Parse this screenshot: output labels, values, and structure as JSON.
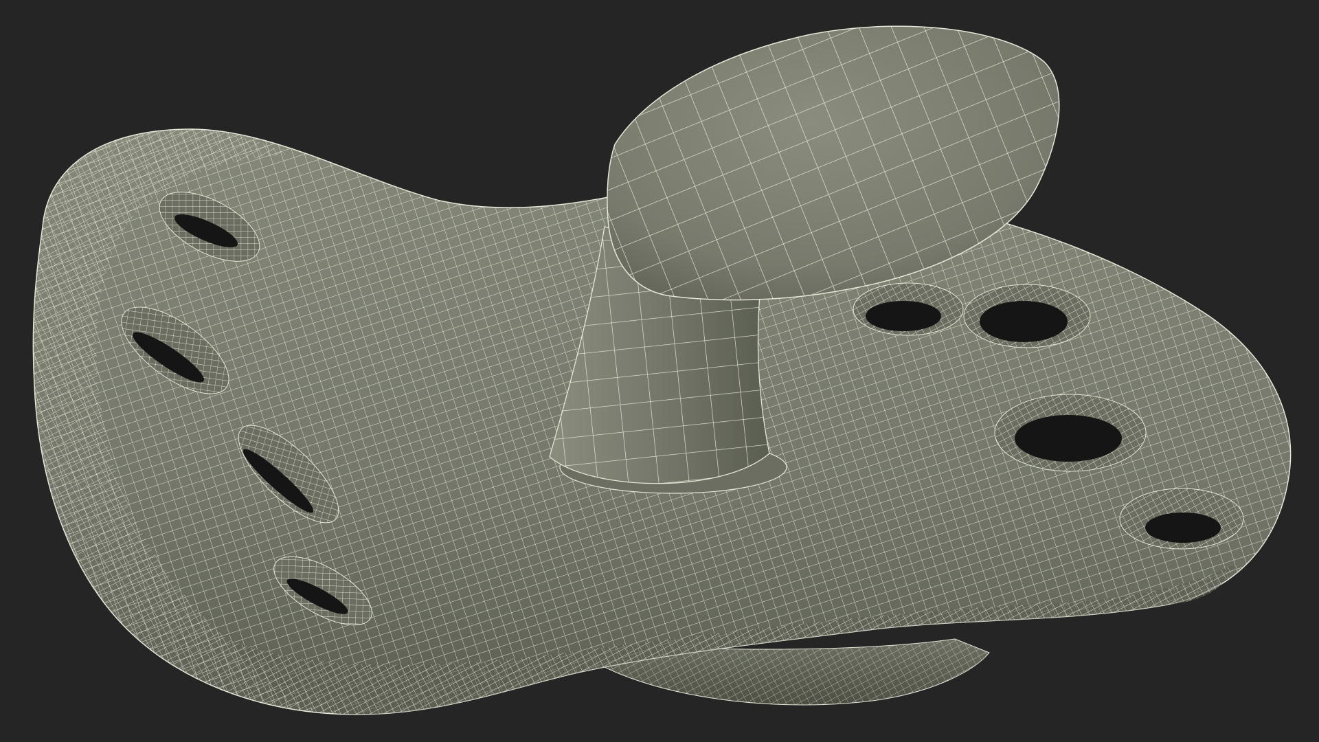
{
  "scene": {
    "subject": "pacifier-wireframe-render",
    "background_color": "#252525",
    "surface_color": "#777a6c",
    "surface_shadow_color": "#5d5f53",
    "wire_color": "#f3f3e6",
    "hole_color": "#151515"
  }
}
